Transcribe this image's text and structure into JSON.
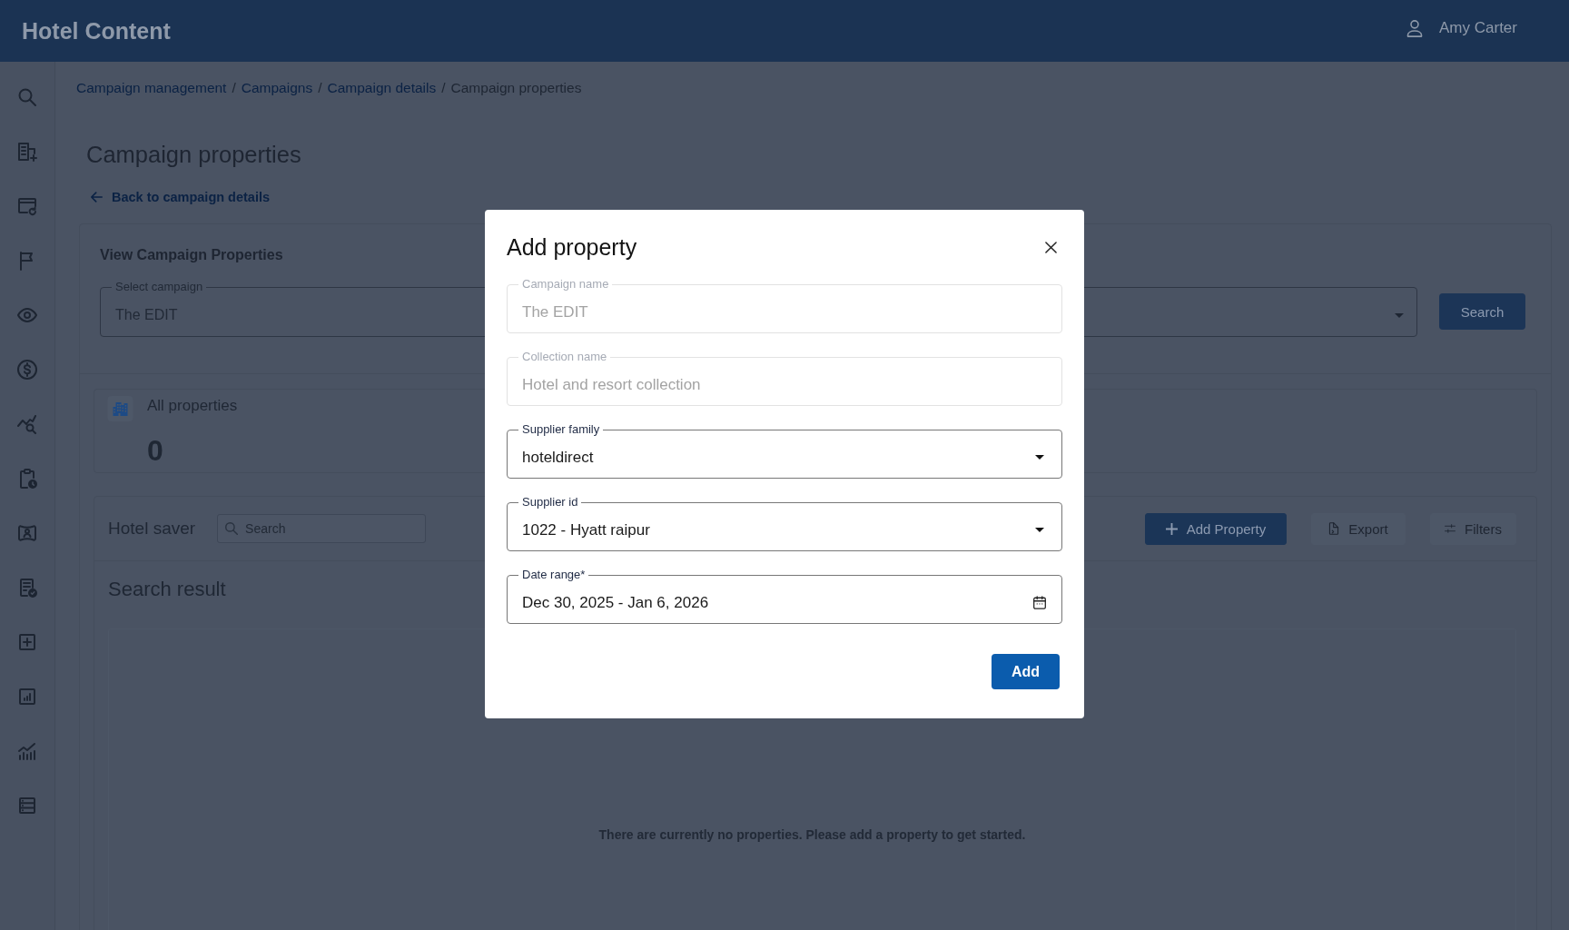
{
  "header": {
    "title": "Hotel Content",
    "user_name": "Amy Carter"
  },
  "breadcrumb": [
    {
      "label": "Campaign management",
      "kind": "link"
    },
    {
      "label": "/",
      "kind": "separator"
    },
    {
      "label": "Campaigns",
      "kind": "link"
    },
    {
      "label": "/",
      "kind": "separator"
    },
    {
      "label": "Campaign details",
      "kind": "link"
    },
    {
      "label": "/",
      "kind": "separator"
    },
    {
      "label": "Campaign properties",
      "kind": "current"
    }
  ],
  "page": {
    "title": "Campaign properties",
    "back_link": "Back to campaign details"
  },
  "campaign_panel": {
    "title": "View Campaign Properties",
    "select": {
      "label": "Select campaign",
      "value": "The EDIT"
    },
    "search_button": "Search"
  },
  "summary": {
    "label": "All properties",
    "count": "0"
  },
  "results": {
    "title": "Hotel saver",
    "search": {
      "placeholder": "Search"
    },
    "buttons": [
      {
        "label": "Add Property",
        "kind": "add",
        "disabled": false
      },
      {
        "label": "Export",
        "kind": "export",
        "disabled": true
      },
      {
        "label": "Filters",
        "kind": "filters",
        "disabled": true
      }
    ],
    "subtitle": "Search result",
    "empty_message": "There are currently no properties. Please add a property to get started."
  },
  "dialog": {
    "title": "Add property",
    "fields": [
      {
        "label": "Campaign name",
        "value": "The EDIT",
        "kind": "text",
        "disabled": true
      },
      {
        "label": "Collection name",
        "value": "Hotel and resort collection",
        "kind": "text",
        "disabled": true
      },
      {
        "label": "Supplier family",
        "value": "hoteldirect",
        "kind": "select",
        "disabled": false
      },
      {
        "label": "Supplier id",
        "value": "1022 - Hyatt raipur",
        "kind": "select",
        "disabled": false
      },
      {
        "label": "Date range*",
        "value": "Dec 30, 2025 - Jan 6, 2026",
        "kind": "date",
        "disabled": false
      }
    ],
    "submit": "Add"
  }
}
